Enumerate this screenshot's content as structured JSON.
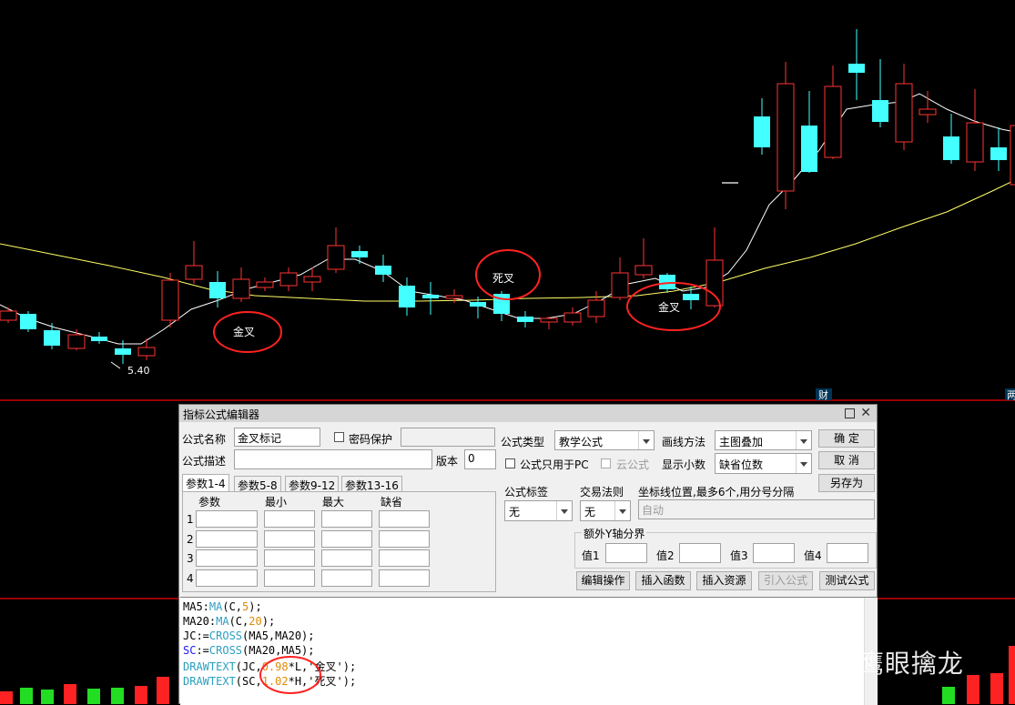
{
  "chart": {
    "price_low_label": "5.40",
    "annotations": [
      "金叉",
      "死叉",
      "金叉"
    ],
    "right_labels": [
      "财",
      "两"
    ],
    "colors": {
      "ma5": "#ffffff",
      "ma20": "#ffff66",
      "up_candle": "#ff3333",
      "down_candle": "#44ffff",
      "annotation_circle": "#ff2222",
      "separator": "#cc0000"
    }
  },
  "dialog": {
    "title": "指标公式编辑器",
    "formula_name_label": "公式名称",
    "formula_name_value": "金叉标记",
    "password_label": "密码保护",
    "formula_desc_label": "公式描述",
    "version_label": "版本",
    "version_value": "0",
    "formula_type_label": "公式类型",
    "formula_type_value": "教学公式",
    "draw_method_label": "画线方法",
    "draw_method_value": "主图叠加",
    "pc_only_label": "公式只用于PC",
    "cloud_label": "云公式",
    "show_decimal_label": "显示小数",
    "show_decimal_value": "缺省位数",
    "ok_button": "确  定",
    "cancel_button": "取  消",
    "save_as_button": "另存为",
    "tabs": [
      "参数1-4",
      "参数5-8",
      "参数9-12",
      "参数13-16"
    ],
    "param_headers": [
      "参数",
      "最小",
      "最大",
      "缺省"
    ],
    "param_rows": [
      "1",
      "2",
      "3",
      "4"
    ],
    "formula_tag_label": "公式标签",
    "formula_tag_value": "无",
    "trade_rule_label": "交易法则",
    "trade_rule_value": "无",
    "axis_label": "坐标线位置,最多6个,用分号分隔",
    "axis_value": "自动",
    "extra_y_label": "额外Y轴分界",
    "value_labels": [
      "值1",
      "值2",
      "值3",
      "值4"
    ],
    "edit_op_button": "编辑操作",
    "insert_fn_button": "插入函数",
    "insert_res_button": "插入资源",
    "import_button": "引入公式",
    "test_button": "测试公式"
  },
  "code": {
    "line1": {
      "a": "MA5:",
      "b": "MA",
      "c": "(C,",
      "d": "5",
      "e": ");"
    },
    "line2": {
      "a": "MA20:",
      "b": "MA",
      "c": "(C,",
      "d": "20",
      "e": ");"
    },
    "line3": {
      "a": "JC:=",
      "b": "CROSS",
      "c": "(MA5,MA20);"
    },
    "line4": {
      "a": "SC",
      "b": ":=",
      "c": "CROSS",
      "d": "(MA20,MA5);"
    },
    "line5": {
      "a": "DRAWTEXT",
      "b": "(JC,",
      "c": "0.98",
      "d": "*L,'",
      "e": "金叉",
      "f": "');"
    },
    "line6": {
      "a": "DRAWTEXT",
      "b": "(SC,",
      "c": "1.02",
      "d": "*H,'",
      "e": "死叉",
      "f": "');"
    }
  },
  "watermark": "知乎 @鹰眼擒龙"
}
